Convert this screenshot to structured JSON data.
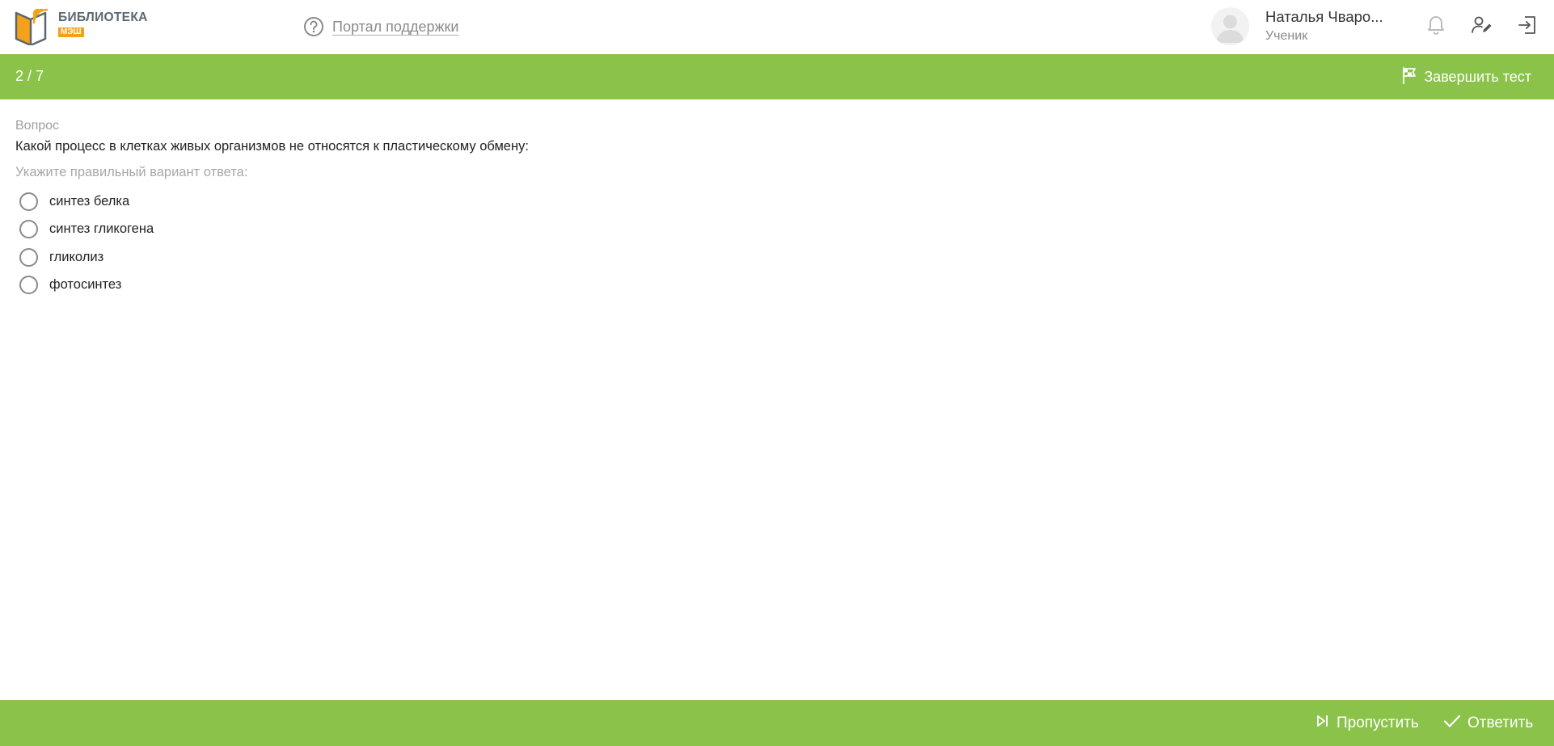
{
  "brand": {
    "title": "БИБЛИОТЕКА",
    "subtitle": "МЭШ",
    "colors": {
      "accent_orange": "#f5a01a",
      "book_gray": "#5b6770"
    }
  },
  "header": {
    "support_link": "Портал поддержки",
    "user": {
      "name": "Наталья Чваро...",
      "role": "Ученик"
    },
    "icons": [
      "help-circle-icon",
      "bell-icon",
      "user-edit-icon",
      "logout-icon"
    ]
  },
  "test_bar": {
    "counter": "2 / 7",
    "finish_label": "Завершить тест",
    "color": "#8bc34a"
  },
  "question": {
    "label": "Вопрос",
    "text": "Какой процесс в клетках живых организмов не относятся к пластическому обмену:",
    "instruction": "Укажите правильный вариант ответа:",
    "options": [
      {
        "label": "синтез белка"
      },
      {
        "label": "синтез гликогена"
      },
      {
        "label": "гликолиз"
      },
      {
        "label": "фотосинтез"
      }
    ]
  },
  "footer": {
    "skip_label": "Пропустить",
    "answer_label": "Ответить"
  }
}
